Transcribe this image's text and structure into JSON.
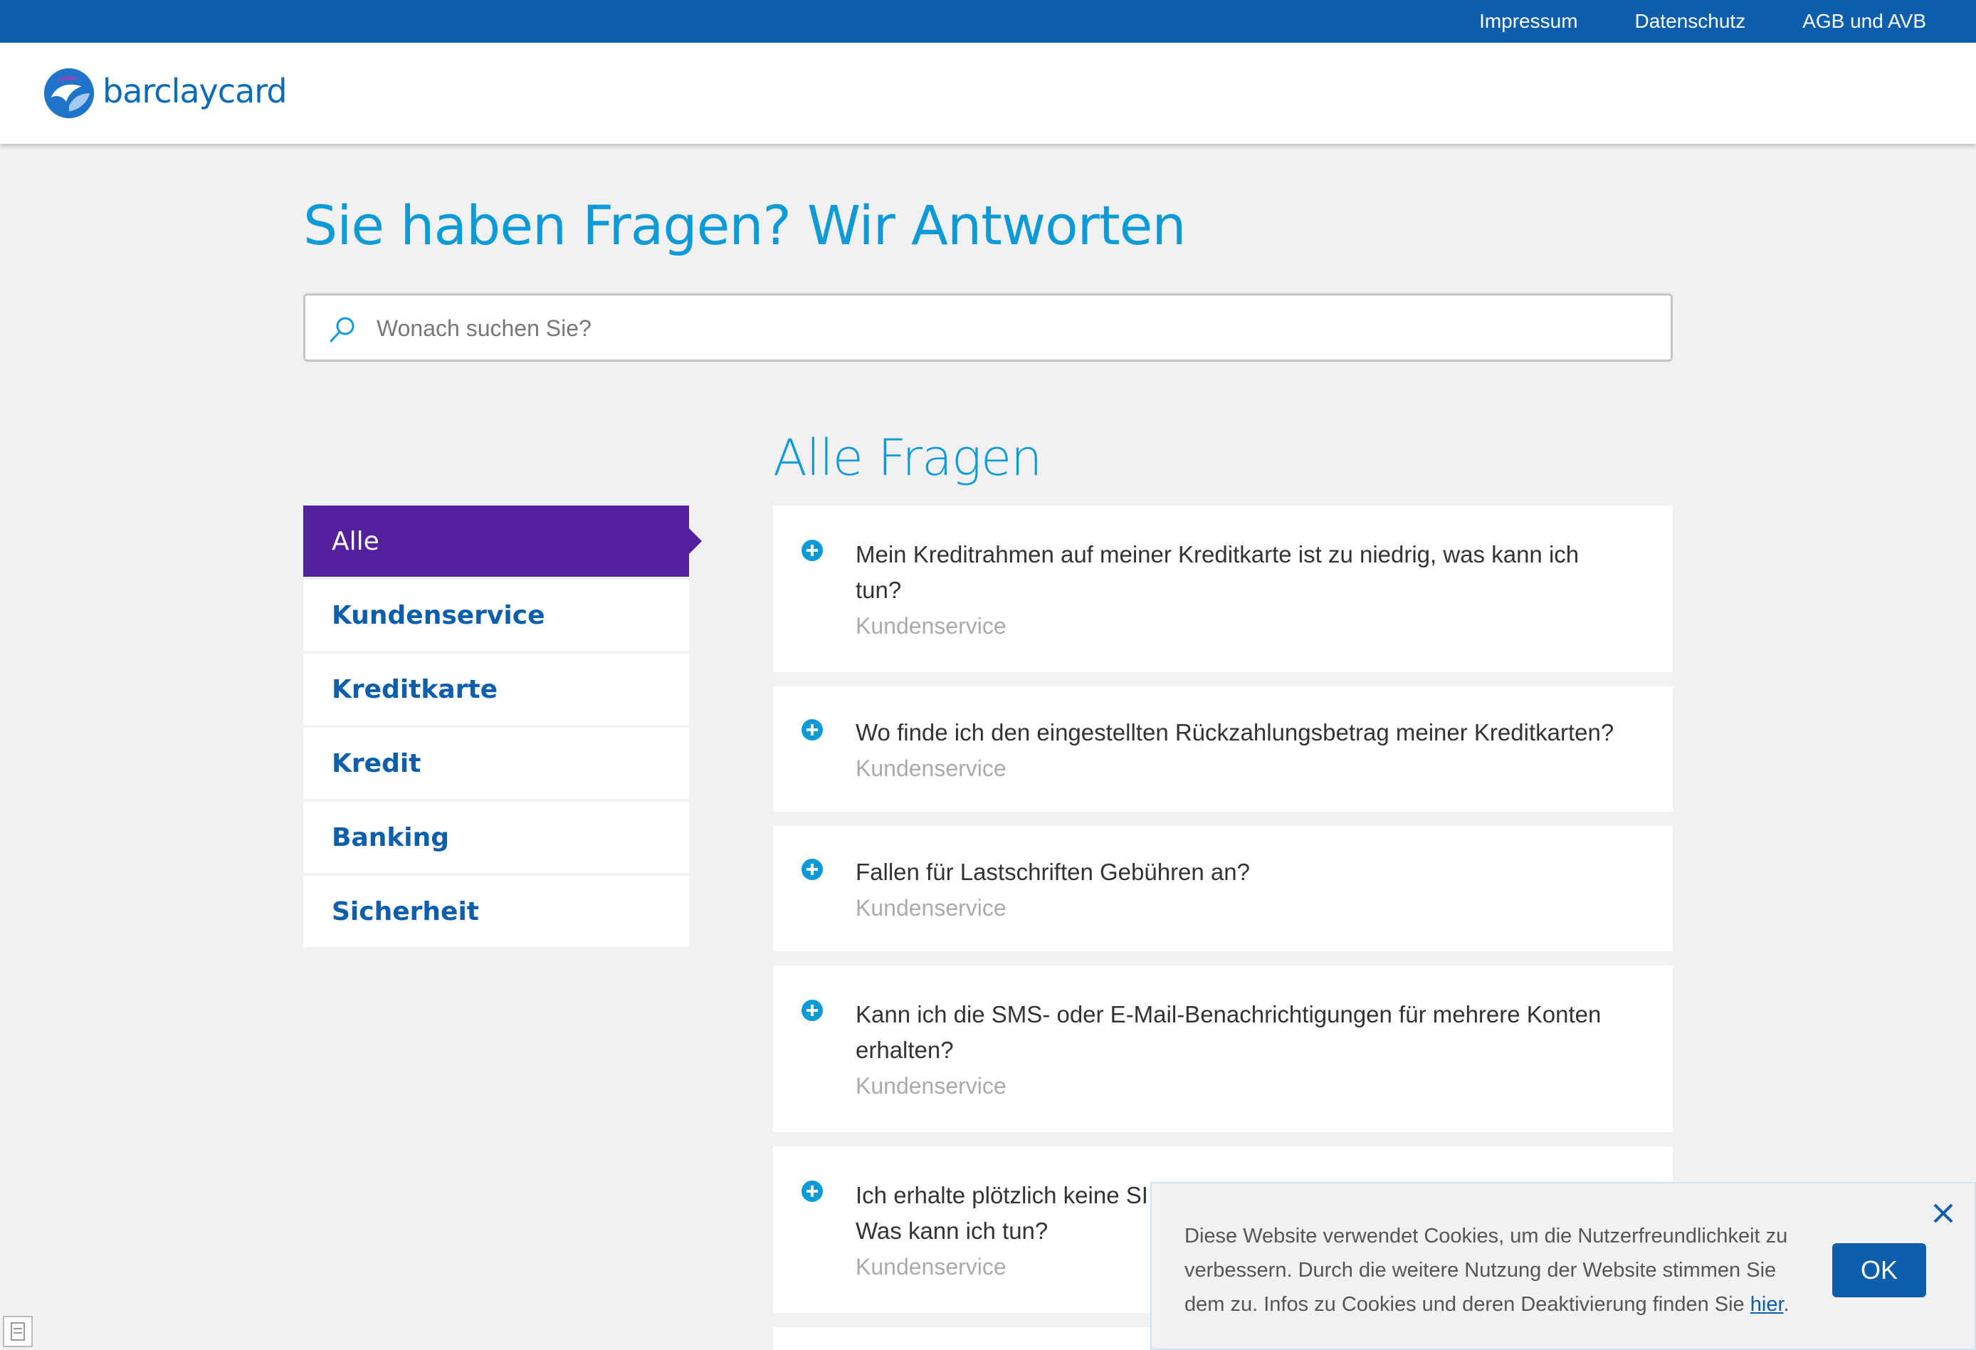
{
  "topnav": {
    "impressum": "Impressum",
    "datenschutz": "Datenschutz",
    "agb": "AGB und AVB"
  },
  "header": {
    "logo_text": "barclaycard"
  },
  "page": {
    "title": "Sie haben Fragen? Wir Antworten",
    "section_title": "Alle Fragen"
  },
  "search": {
    "placeholder": "Wonach suchen Sie?",
    "value": ""
  },
  "sidebar": {
    "items": [
      {
        "label": "Alle",
        "active": true
      },
      {
        "label": "Kundenservice"
      },
      {
        "label": "Kreditkarte"
      },
      {
        "label": "Kredit"
      },
      {
        "label": "Banking"
      },
      {
        "label": "Sicherheit"
      }
    ]
  },
  "faqs": [
    {
      "question": "Mein Kreditrahmen auf meiner Kreditkarte ist zu niedrig, was kann ich tun?",
      "category": "Kundenservice"
    },
    {
      "question": "Wo finde ich den eingestellten Rückzahlungsbetrag meiner Kreditkarten?",
      "category": "Kundenservice"
    },
    {
      "question": "Fallen für Lastschriften Gebühren an?",
      "category": "Kundenservice"
    },
    {
      "question": "Kann ich die SMS- oder E-Mail-Benachrichtigungen für mehrere Konten erhalten?",
      "category": "Kundenservice"
    },
    {
      "question": "Ich erhalte plötzlich keine SMS mehr. Was kann ich tun?",
      "question_visible": "Ich erhalte plötzlich keine SI",
      "question_line2": "Was kann ich tun?",
      "category": "Kundenservice"
    }
  ],
  "cookie": {
    "text": "Diese Website verwendet Cookies, um die Nutzerfreundlichkeit zu verbessern. Durch die weitere Nutzung der Website stimmen Sie dem zu. Infos zu Cookies und deren Deaktivierung finden Sie ",
    "link": "hier",
    "suffix": ".",
    "ok_label": "OK"
  },
  "colors": {
    "brand_blue": "#0d5eab",
    "accent_cyan": "#0d9bd8",
    "active_purple": "#53209e"
  }
}
